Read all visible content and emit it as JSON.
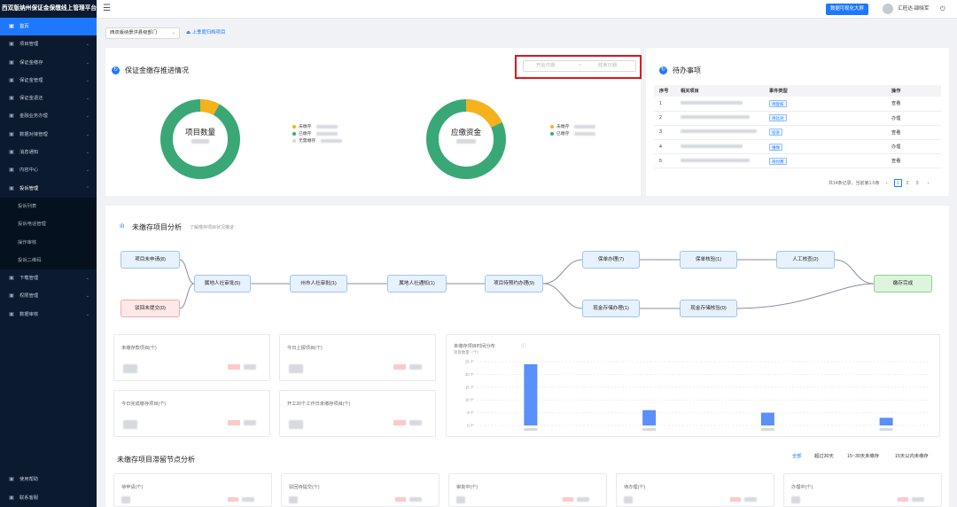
{
  "app": {
    "title": "西双版纳州保证金保缴线上管理平台"
  },
  "sidebar": {
    "items": [
      {
        "label": "首页",
        "icon": "home-icon",
        "active": true
      },
      {
        "label": "项目管理",
        "icon": "project-icon"
      },
      {
        "label": "保证金缴存",
        "icon": "deposit-icon"
      },
      {
        "label": "保证金管理",
        "icon": "manage-icon"
      },
      {
        "label": "保证金退还",
        "icon": "refund-icon"
      },
      {
        "label": "金融业务办理",
        "icon": "finance-icon"
      },
      {
        "label": "数据对接管理",
        "icon": "data-icon"
      },
      {
        "label": "消息通知",
        "icon": "bell-icon"
      },
      {
        "label": "内容中心",
        "icon": "content-icon"
      },
      {
        "label": "投诉管理",
        "icon": "complaint-icon",
        "open": true
      }
    ],
    "sub_items": [
      "投诉列表",
      "投诉电话管理",
      "操作审核",
      "投诉二维码"
    ],
    "items_after": [
      {
        "label": "下载管理",
        "icon": "download-icon"
      },
      {
        "label": "权限管理",
        "icon": "lock-icon"
      },
      {
        "label": "数据审核",
        "icon": "audit-icon"
      }
    ],
    "bottom": [
      {
        "label": "使用帮助",
        "icon": "help-icon"
      },
      {
        "label": "联系客服",
        "icon": "service-icon"
      }
    ]
  },
  "header": {
    "bigscreen_label": "数据可视化大屏",
    "user_name": "汇旺达-邵晓军"
  },
  "filters": {
    "project_select": "西双版纳景洪县级部门",
    "archive_link": "上季度归档项目"
  },
  "progress": {
    "title": "保证金缴存推进情况",
    "date_start_placeholder": "开始日期",
    "date_sep": "~",
    "date_end_placeholder": "结束日期",
    "donut1": {
      "center_label": "项目数量",
      "unpaid_fraction": 0.08
    },
    "donut1_legend": [
      {
        "label": "未缴存",
        "color": "#f5b21c"
      },
      {
        "label": "已缴存",
        "color": "#3aa876"
      },
      {
        "label": "无需缴存",
        "color": "#d9d9d9"
      }
    ],
    "donut2": {
      "center_label": "应缴资金",
      "unpaid_fraction": 0.18
    },
    "donut2_legend": [
      {
        "label": "未缴存",
        "color": "#f5b21c"
      },
      {
        "label": "已缴存",
        "color": "#3aa876"
      }
    ]
  },
  "todo": {
    "title": "待办事项",
    "columns": [
      "序号",
      "相关项目",
      "事件类型",
      "操作"
    ],
    "rows": [
      {
        "no": "1",
        "type": "待复核",
        "action": "查看"
      },
      {
        "no": "2",
        "type": "待比对",
        "action": "办理"
      },
      {
        "no": "3",
        "type": "投诉",
        "action": "查看"
      },
      {
        "no": "4",
        "type": "维保",
        "action": "办理"
      },
      {
        "no": "5",
        "type": "待付费",
        "action": "查看"
      }
    ],
    "pager_text": "共14条记录，当前第1-5条",
    "pages": [
      "1",
      "2",
      "3"
    ],
    "current_page": "1"
  },
  "flow": {
    "title": "未缴存项目分析",
    "subtitle": "了解缴存项目状况推进",
    "nodes": {
      "n1": "项目未申请(8)",
      "n2": "驳回未提交(0)",
      "n3": "属地人社审批(5)",
      "n4": "州市人社审批(1)",
      "n5": "属地人社通知(1)",
      "n6": "项目待预约办理(9)",
      "n7": "保单办理(7)",
      "n8": "保单核验(1)",
      "n9": "人工核查(2)",
      "n10": "现金存储办理(1)",
      "n11": "现金存储核验(0)",
      "n12": "缴存完成"
    }
  },
  "stats": [
    {
      "label": "未缴存款项目(个)"
    },
    {
      "label": "今日上报项目(个)"
    },
    {
      "label": "今日完成缴存项目(个)"
    },
    {
      "label": "开工20个工作日未缴存项目(个)"
    }
  ],
  "chart_data": {
    "type": "bar",
    "title": "未缴存项目时间分布",
    "ylabel": "项目数量（个）",
    "yticks": [
      "25 个",
      "20 个",
      "15 个",
      "10 个",
      "5 个",
      "0 个"
    ],
    "ylim": [
      0,
      25
    ],
    "values": [
      24,
      6,
      5,
      3
    ],
    "color": "#5b8ff9",
    "grid": true
  },
  "retention": {
    "title": "未缴存项目滞留节点分析",
    "segments": [
      "全部",
      "超过30天",
      "15~30天未缴存",
      "15天以内未缴存"
    ],
    "active_segment": "全部",
    "cards": [
      {
        "label": "待申请(个)"
      },
      {
        "label": "驳回待提交(个)"
      },
      {
        "label": "审批中(个)"
      },
      {
        "label": "待办理(个)"
      },
      {
        "label": "办理中(个)"
      }
    ]
  }
}
